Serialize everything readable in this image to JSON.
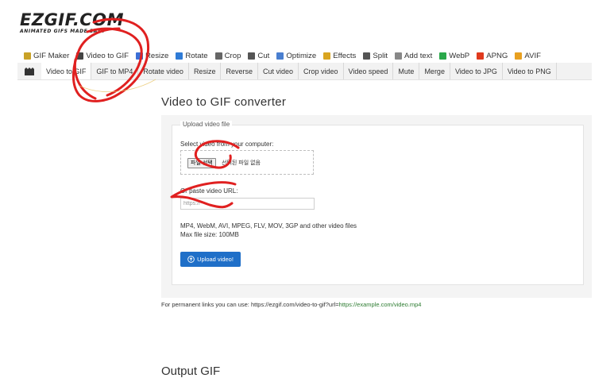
{
  "logo": {
    "main": "EZGIF.COM",
    "sub": "ANIMATED GIFS MADE EASY"
  },
  "main_nav": [
    {
      "label": "GIF Maker",
      "icon": "gif-maker-icon",
      "color": "#c9a227"
    },
    {
      "label": "Video to GIF",
      "icon": "video-icon",
      "color": "#444444"
    },
    {
      "label": "Resize",
      "icon": "resize-icon",
      "color": "#3b6fd6"
    },
    {
      "label": "Rotate",
      "icon": "rotate-icon",
      "color": "#2f7bd6"
    },
    {
      "label": "Crop",
      "icon": "crop-icon",
      "color": "#666666"
    },
    {
      "label": "Cut",
      "icon": "cut-icon",
      "color": "#555555"
    },
    {
      "label": "Optimize",
      "icon": "optimize-icon",
      "color": "#4a7fd0"
    },
    {
      "label": "Effects",
      "icon": "effects-icon",
      "color": "#d9a520"
    },
    {
      "label": "Split",
      "icon": "split-icon",
      "color": "#555555"
    },
    {
      "label": "Add text",
      "icon": "add-text-icon",
      "color": "#888888"
    },
    {
      "label": "WebP",
      "icon": "webp-icon",
      "color": "#2aa84a"
    },
    {
      "label": "APNG",
      "icon": "apng-icon",
      "color": "#e03a1e"
    },
    {
      "label": "AVIF",
      "icon": "avif-icon",
      "color": "#e8a020"
    }
  ],
  "sub_nav": {
    "icon": "film-icon",
    "tabs": [
      "Video to GIF",
      "GIF to MP4",
      "Rotate video",
      "Resize",
      "Reverse",
      "Cut video",
      "Crop video",
      "Video speed",
      "Mute",
      "Merge",
      "Video to JPG",
      "Video to PNG"
    ],
    "active": "Video to GIF"
  },
  "page_title": "Video to GIF converter",
  "upload": {
    "legend": "Upload video file",
    "select_label": "Select video from your computer:",
    "file_button": "파일 선택",
    "file_status": "선택된 파일 없음",
    "url_label": "Or paste video URL:",
    "url_placeholder": "https://",
    "formats": "MP4, WebM, AVI, MPEG, FLV, MOV, 3GP and other video files",
    "max_size": "Max file size: 100MB",
    "button": "Upload video!"
  },
  "permanent": {
    "prefix": "For permanent links you can use: https://ezgif.com/video-to-gif?url=",
    "example": "https://example.com/video.mp4"
  },
  "output_title": "Output GIF",
  "colors": {
    "accent": "#1f6fc8",
    "annotation": "#e02020",
    "subnav_bg": "#f2f2f2"
  }
}
